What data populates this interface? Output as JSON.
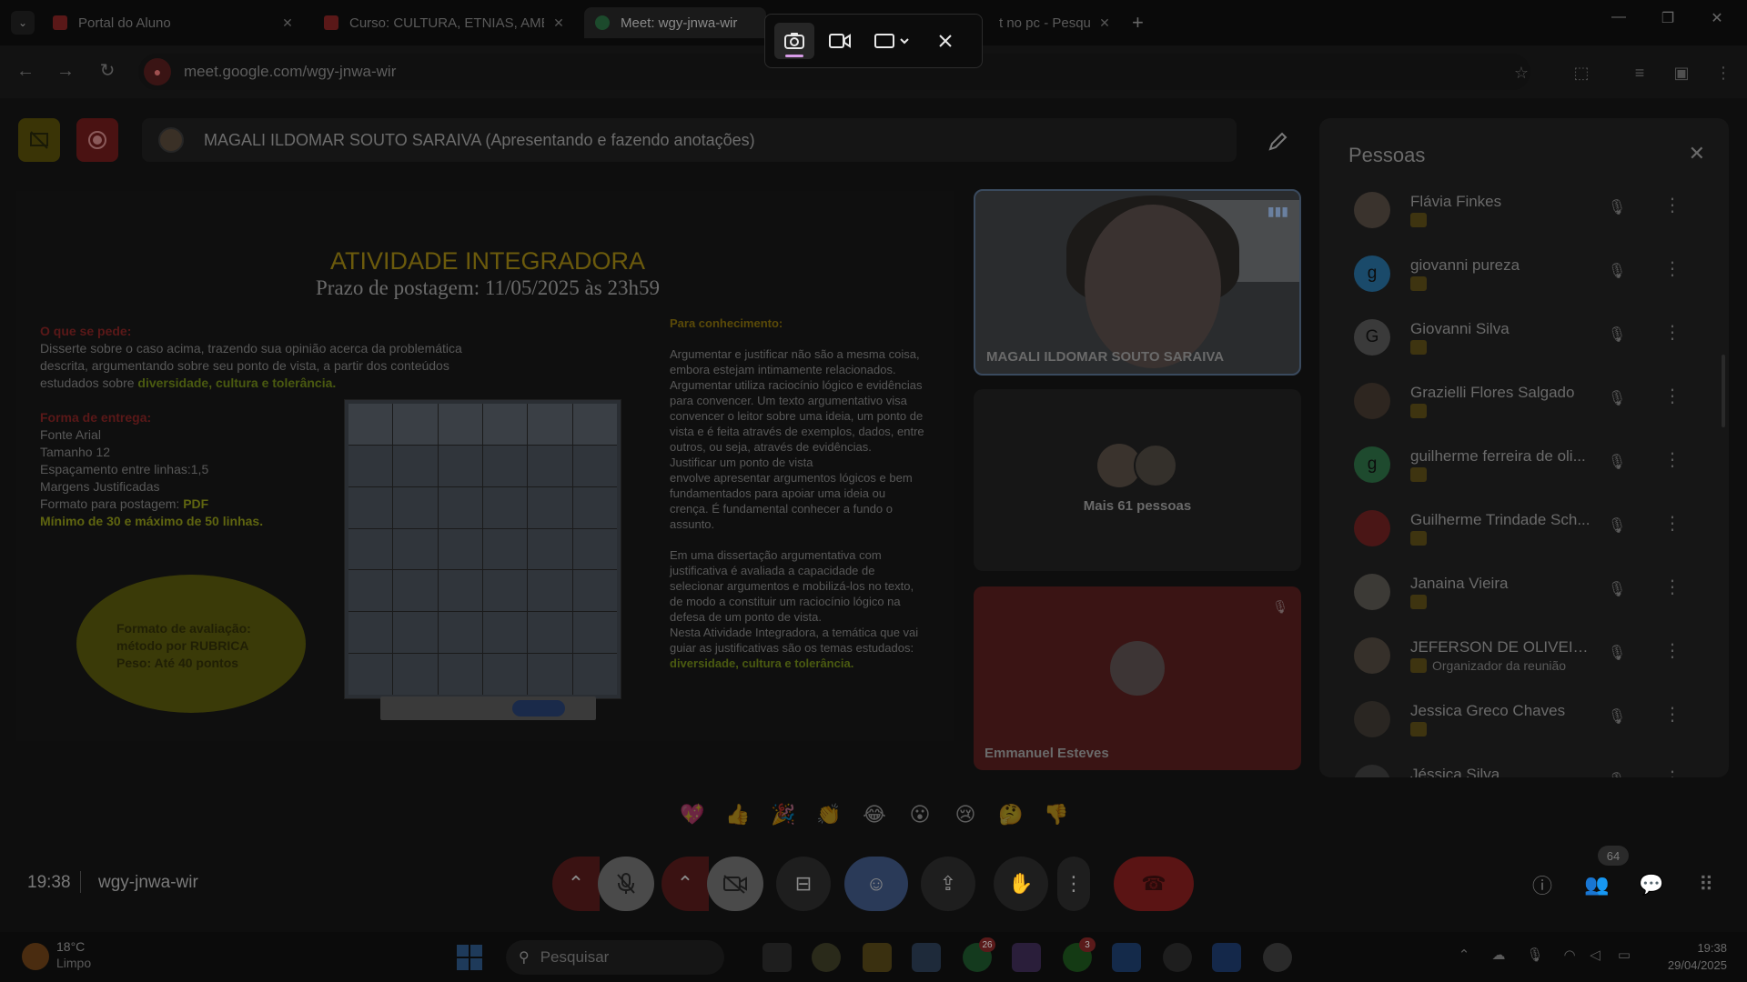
{
  "browser": {
    "tabs": [
      {
        "label": "Portal do Aluno",
        "icon": "ulbra-favicon",
        "color": "#5a1818"
      },
      {
        "label": "Curso: CULTURA, ETNIAS, AMB",
        "icon": "ulbra-favicon",
        "color": "#5a1818"
      },
      {
        "label": "Meet: wgy-jnwa-wir",
        "icon": "meet-favicon",
        "color": "#1c4a2c"
      },
      {
        "label": "t no pc - Pesqui",
        "icon": "google-favicon",
        "color": "#2c2c2c"
      }
    ],
    "url": "meet.google.com/wgy-jnwa-wir"
  },
  "presenter_banner": "MAGALI ILDOMAR SOUTO SARAIVA (Apresentando e fazendo anotações)",
  "slide": {
    "title": "ATIVIDADE INTEGRADORA",
    "subtitle": "Prazo de postagem: 11/05/2025 às 23h59",
    "left": {
      "heading1": "O que se pede:",
      "task_line1": "Disserte sobre o caso acima, trazendo sua opinião acerca da problemática",
      "task_line2": "descrita, argumentando sobre seu ponto de vista, a partir dos conteúdos",
      "task_line3_prefix": "estudados sobre ",
      "task_line3_highlight": "diversidade, cultura e tolerância.",
      "heading2": "Forma de entrega:",
      "font": "Fonte Arial",
      "size": "Tamanho 12",
      "spacing": "Espaçamento entre linhas:1,5",
      "margins": "Margens Justificadas",
      "format_prefix": "Formato para postagem: ",
      "format_value": "PDF",
      "lines": "Mínimo de 30 e máximo de 50 linhas."
    },
    "ellipse": {
      "line1": "Formato de avaliação:",
      "line2": "método por RUBRICA",
      "line3": "Peso: Até 40 pontos"
    },
    "right": {
      "heading": "Para conhecimento:",
      "p1": "Argumentar e justificar não são a mesma coisa, embora estejam intimamente relacionados.",
      "p2": "Argumentar utiliza raciocínio lógico e evidências para convencer. Um texto argumentativo visa convencer o leitor sobre uma ideia, um ponto de vista e é feita através de exemplos, dados, entre outros, ou seja, através de evidências.",
      "p3": "Justificar um ponto de vista",
      "p4": "envolve apresentar argumentos lógicos e bem fundamentados para apoiar uma ideia ou crença. É fundamental conhecer a fundo o assunto.",
      "p5": "Em uma dissertação argumentativa com justificativa é avaliada a capacidade de selecionar argumentos e mobilizá-los no texto, de modo a constituir um raciocínio lógico na defesa de um ponto de vista.",
      "p6": "Nesta Atividade Integradora, a temática que vai guiar as justificativas são os temas estudados: ",
      "p6_highlight": "diversidade, cultura e tolerância."
    }
  },
  "tiles": {
    "speaker": "MAGALI ILDOMAR SOUTO SARAIVA",
    "more": "Mais 61 pessoas",
    "last": "Emmanuel Esteves"
  },
  "people": {
    "title": "Pessoas",
    "list": [
      {
        "name": "Flávia Finkes",
        "role": "",
        "initial": "",
        "color": "#3a332d"
      },
      {
        "name": "giovanni pureza",
        "role": "",
        "initial": "g",
        "color": "#1a4a6a"
      },
      {
        "name": "Giovanni Silva",
        "role": "",
        "initial": "G",
        "color": "#3a3a3a"
      },
      {
        "name": "Grazielli Flores Salgado",
        "role": "",
        "initial": "",
        "color": "#2e2620"
      },
      {
        "name": "guilherme ferreira de oli...",
        "role": "",
        "initial": "g",
        "color": "#1e4a2e"
      },
      {
        "name": "Guilherme Trindade Sch...",
        "role": "",
        "initial": "",
        "color": "#4a1616"
      },
      {
        "name": "Janaina Vieira",
        "role": "",
        "initial": "",
        "color": "#3c3a36"
      },
      {
        "name": "JEFERSON DE OLIVEIRA...",
        "role": "Organizador da reunião",
        "initial": "",
        "color": "#36302a"
      },
      {
        "name": "Jessica Greco Chaves",
        "role": "",
        "initial": "",
        "color": "#2a2622"
      },
      {
        "name": "Jéssica Silva",
        "role": "",
        "initial": "",
        "color": "#2a2a2a"
      }
    ]
  },
  "reactions": [
    "💖",
    "👍",
    "🎉",
    "👏",
    "😂",
    "😮",
    "😢",
    "🤔",
    "👎"
  ],
  "meetbar": {
    "time": "19:38",
    "code": "wgy-jnwa-wir",
    "participant_count": "64"
  },
  "taskbar": {
    "temp": "18°C",
    "condition": "Limpo",
    "search_placeholder": "Pesquisar",
    "whatsapp_badge": "26",
    "xbox_badge": "3",
    "time": "19:38",
    "date": "29/04/2025"
  },
  "icons": {
    "capture_screenshot": "camera-icon",
    "capture_video": "video-icon",
    "capture_region": "region-select-icon",
    "capture_close": "close-icon"
  }
}
